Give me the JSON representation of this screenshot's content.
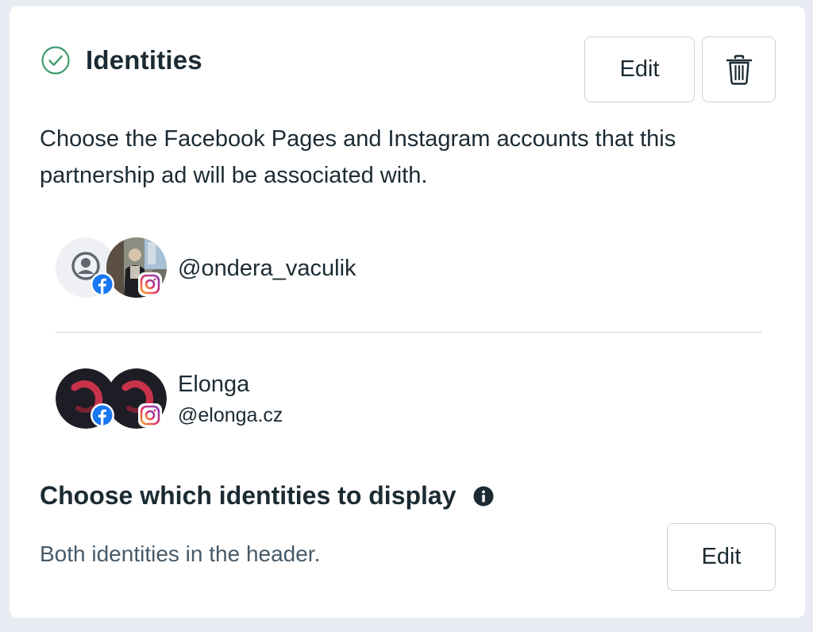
{
  "identities_section": {
    "title": "Identities",
    "status_icon": "check-circle-icon",
    "edit_label": "Edit",
    "delete_icon": "trash-icon",
    "description": "Choose the Facebook Pages and Instagram accounts that this partnership ad will be associated with."
  },
  "identities": [
    {
      "handle": "@ondera_vaculik",
      "facebook_avatar": "default-profile-icon",
      "instagram_avatar": "profile-photo"
    },
    {
      "name": "Elonga",
      "handle": "@elonga.cz",
      "facebook_avatar": "elonga-logo",
      "instagram_avatar": "elonga-logo"
    }
  ],
  "display_section": {
    "title": "Choose which identities to display",
    "info_icon": "info-icon",
    "description": "Both identities in the header.",
    "edit_label": "Edit"
  },
  "colors": {
    "check_green": "#3f9b6c",
    "facebook_blue": "#1877f2",
    "elonga_dark": "#1e1d26",
    "elonga_red": "#c8324a"
  }
}
